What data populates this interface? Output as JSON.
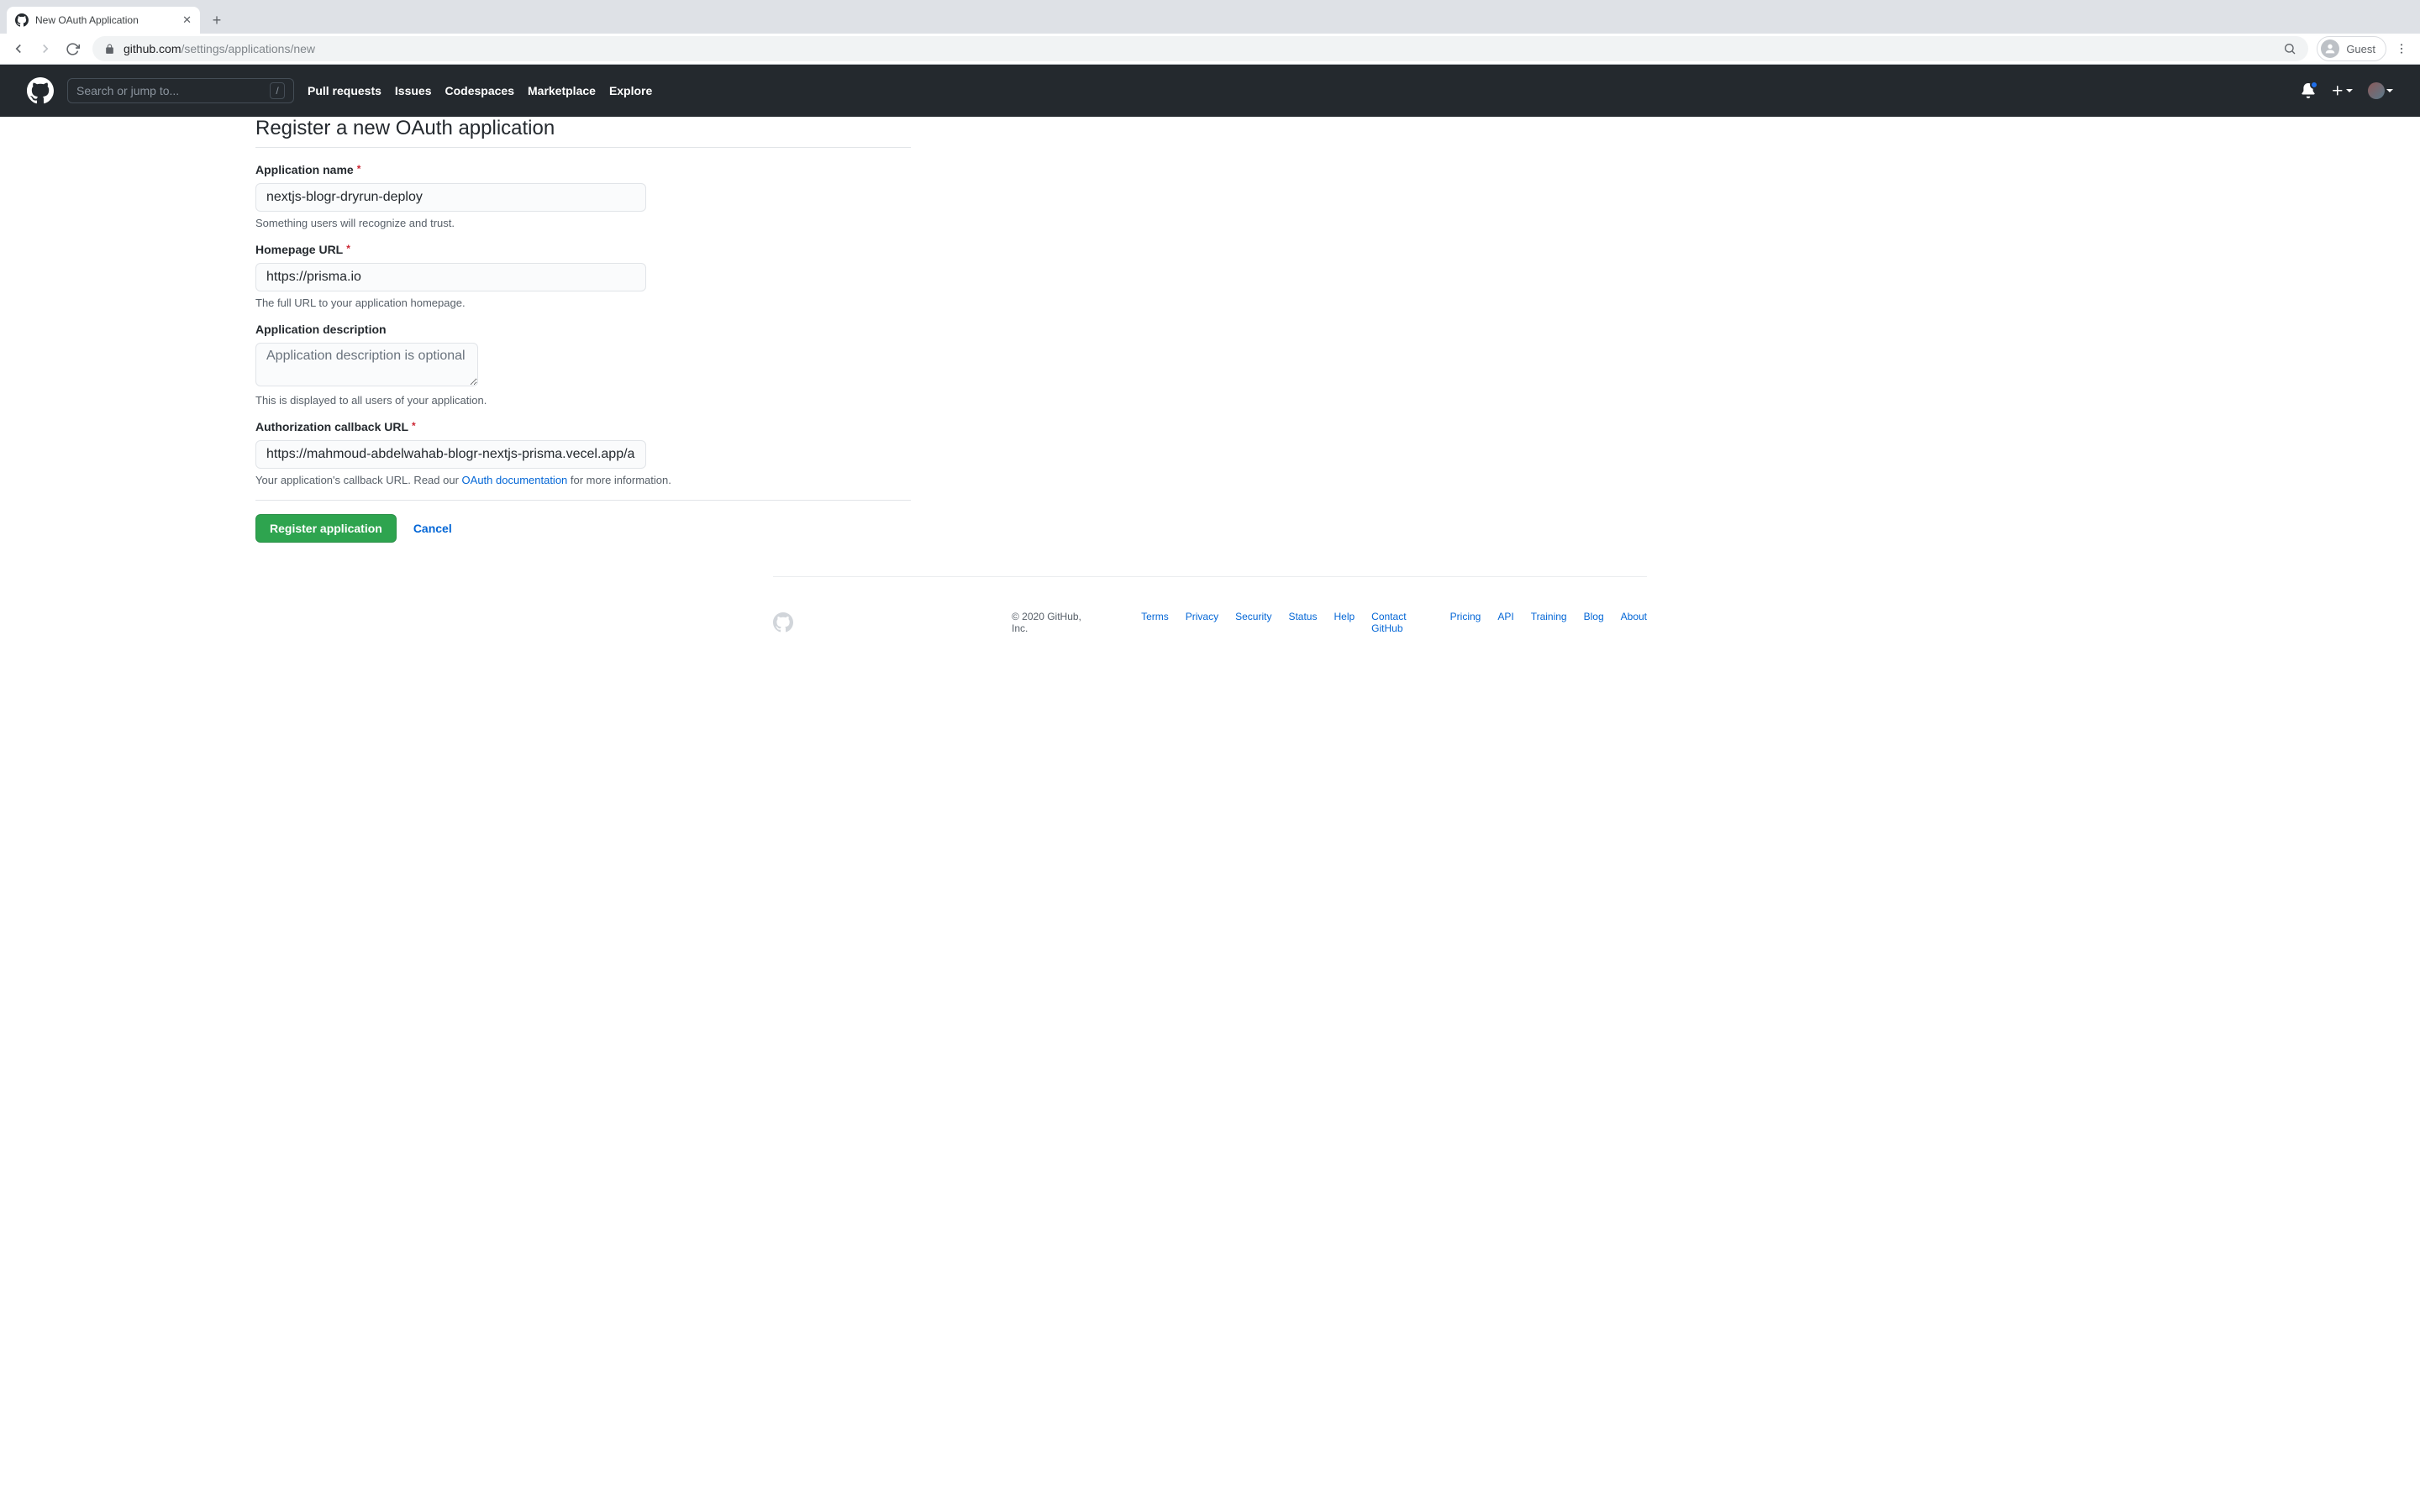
{
  "browser": {
    "tab_title": "New OAuth Application",
    "url_host": "github.com",
    "url_path": "/settings/applications/new",
    "guest_label": "Guest"
  },
  "header": {
    "search_placeholder": "Search or jump to...",
    "nav": [
      "Pull requests",
      "Issues",
      "Codespaces",
      "Marketplace",
      "Explore"
    ]
  },
  "page": {
    "title": "Register a new OAuth application",
    "fields": {
      "app_name": {
        "label": "Application name",
        "required": true,
        "value": "nextjs-blogr-dryrun-deploy",
        "hint": "Something users will recognize and trust."
      },
      "homepage_url": {
        "label": "Homepage URL",
        "required": true,
        "value": "https://prisma.io",
        "hint": "The full URL to your application homepage."
      },
      "description": {
        "label": "Application description",
        "required": false,
        "value": "",
        "placeholder": "Application description is optional",
        "hint": "This is displayed to all users of your application."
      },
      "callback_url": {
        "label": "Authorization callback URL",
        "required": true,
        "value": "https://mahmoud-abdelwahab-blogr-nextjs-prisma.vecel.app/api/",
        "hint_prefix": "Your application's callback URL. Read our ",
        "hint_link": "OAuth documentation",
        "hint_suffix": " for more information."
      }
    },
    "actions": {
      "submit": "Register application",
      "cancel": "Cancel"
    }
  },
  "footer": {
    "copyright": "© 2020 GitHub, Inc.",
    "links": [
      "Terms",
      "Privacy",
      "Security",
      "Status",
      "Help",
      "Contact GitHub",
      "Pricing",
      "API",
      "Training",
      "Blog",
      "About"
    ]
  }
}
